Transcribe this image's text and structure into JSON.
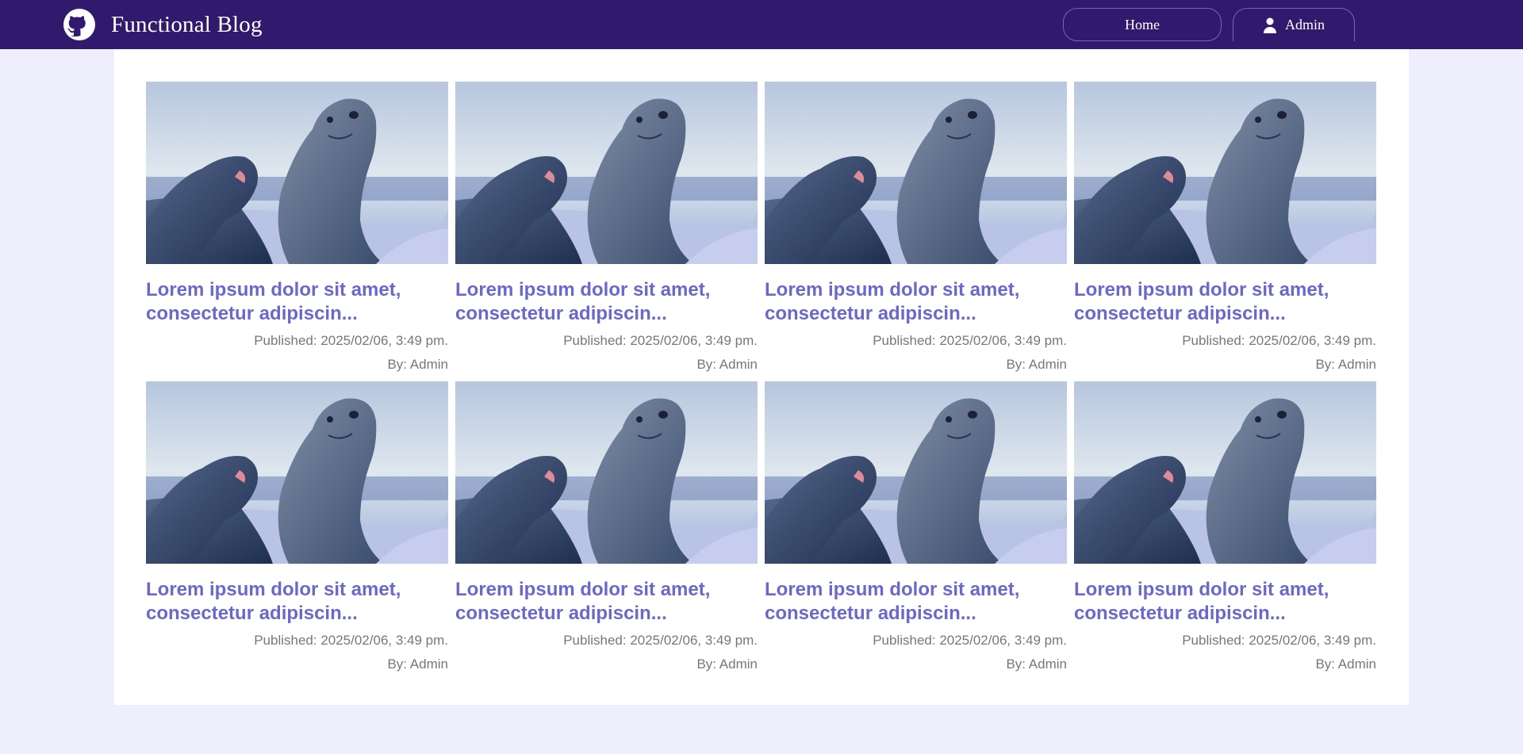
{
  "header": {
    "title": "Functional Blog",
    "logo_icon": "github-icon",
    "nav": {
      "home_label": "Home",
      "admin_label": "Admin"
    },
    "colors": {
      "bar": "#311a6e",
      "accent": "#6a68cc"
    }
  },
  "posts": [
    {
      "title": "Lorem ipsum dolor sit amet, consectetur adipiscin...",
      "published": "Published: 2025/02/06, 3:49 pm.",
      "author": "By: Admin"
    },
    {
      "title": "Lorem ipsum dolor sit amet, consectetur adipiscin...",
      "published": "Published: 2025/02/06, 3:49 pm.",
      "author": "By: Admin"
    },
    {
      "title": "Lorem ipsum dolor sit amet, consectetur adipiscin...",
      "published": "Published: 2025/02/06, 3:49 pm.",
      "author": "By: Admin"
    },
    {
      "title": "Lorem ipsum dolor sit amet, consectetur adipiscin...",
      "published": "Published: 2025/02/06, 3:49 pm.",
      "author": "By: Admin"
    },
    {
      "title": "Lorem ipsum dolor sit amet, consectetur adipiscin...",
      "published": "Published: 2025/02/06, 3:49 pm.",
      "author": "By: Admin"
    },
    {
      "title": "Lorem ipsum dolor sit amet, consectetur adipiscin...",
      "published": "Published: 2025/02/06, 3:49 pm.",
      "author": "By: Admin"
    },
    {
      "title": "Lorem ipsum dolor sit amet, consectetur adipiscin...",
      "published": "Published: 2025/02/06, 3:49 pm.",
      "author": "By: Admin"
    },
    {
      "title": "Lorem ipsum dolor sit amet, consectetur adipiscin...",
      "published": "Published: 2025/02/06, 3:49 pm.",
      "author": "By: Admin"
    }
  ]
}
